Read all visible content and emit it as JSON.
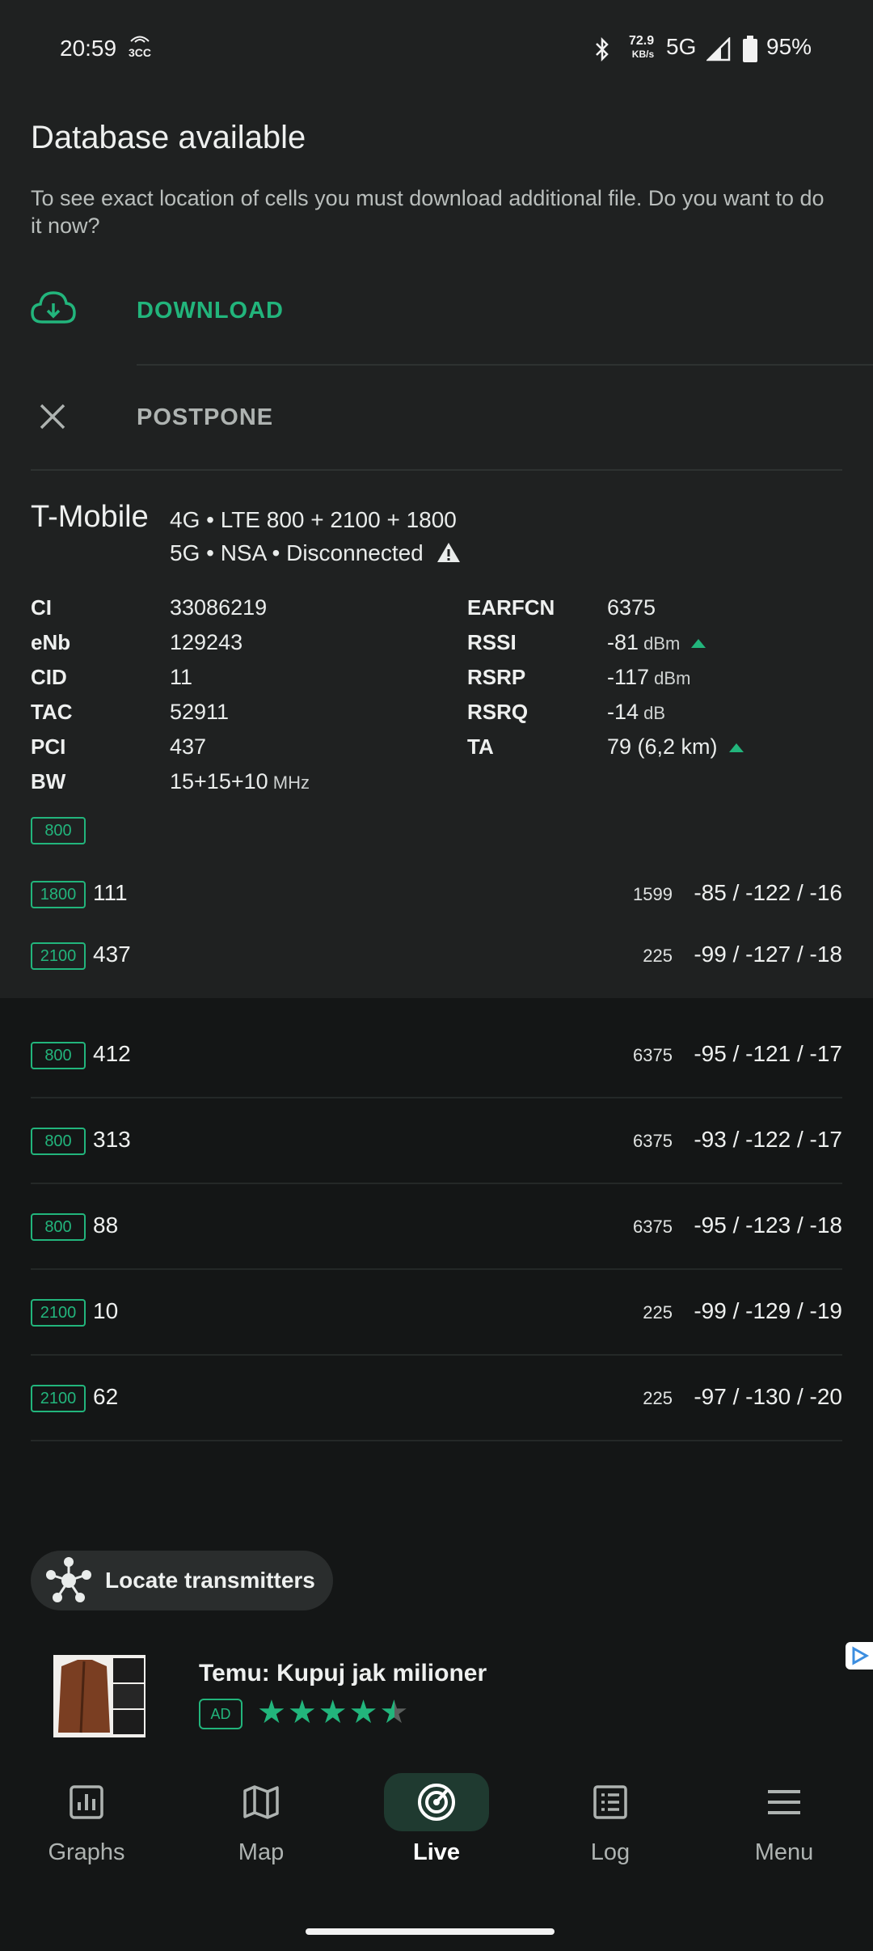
{
  "status_bar": {
    "time": "20:59",
    "carrier_icon_text": "3CC",
    "speed_value": "72.9",
    "speed_unit": "KB/s",
    "network": "5G",
    "battery": "95%"
  },
  "dialog": {
    "title": "Database available",
    "text": "To see exact location of cells you must download additional file. Do you want to do it now?",
    "download_label": "DOWNLOAD",
    "postpone_label": "POSTPONE"
  },
  "serving": {
    "carrier": "T-Mobile",
    "tech_line1": "4G • LTE 800 + 2100 + 1800",
    "tech_line2": "5G • NSA • Disconnected",
    "left_params": [
      {
        "key": "CI",
        "value": "33086219",
        "unit": ""
      },
      {
        "key": "eNb",
        "value": "129243",
        "unit": ""
      },
      {
        "key": "CID",
        "value": "11",
        "unit": ""
      },
      {
        "key": "TAC",
        "value": "52911",
        "unit": ""
      },
      {
        "key": "PCI",
        "value": "437",
        "unit": ""
      },
      {
        "key": "BW",
        "value": "15+15+10",
        "unit": "MHz"
      }
    ],
    "right_params": [
      {
        "key": "EARFCN",
        "value": "6375",
        "unit": ""
      },
      {
        "key": "RSSI",
        "value": "-81",
        "unit": "dBm"
      },
      {
        "key": "RSRP",
        "value": "-117",
        "unit": "dBm"
      },
      {
        "key": "RSRQ",
        "value": "-14",
        "unit": "dB"
      },
      {
        "key": "TA",
        "value": "79 (6,2 km)",
        "unit": ""
      }
    ],
    "primary_band": "800",
    "aggregated": [
      {
        "band": "1800",
        "pci": "111",
        "freq": "1599",
        "signal": "-85 / -122 / -16"
      },
      {
        "band": "2100",
        "pci": "437",
        "freq": "225",
        "signal": "-99 / -127 / -18"
      }
    ]
  },
  "neighbors": [
    {
      "band": "800",
      "pci": "412",
      "freq": "6375",
      "signal": "-95 / -121 / -17"
    },
    {
      "band": "800",
      "pci": "313",
      "freq": "6375",
      "signal": "-93 / -122 / -17"
    },
    {
      "band": "800",
      "pci": "88",
      "freq": "6375",
      "signal": "-95 / -123 / -18"
    },
    {
      "band": "2100",
      "pci": "10",
      "freq": "225",
      "signal": "-99 / -129 / -19"
    },
    {
      "band": "2100",
      "pci": "62",
      "freq": "225",
      "signal": "-97 / -130 / -20"
    }
  ],
  "locate_button": "Locate transmitters",
  "ad": {
    "title": "Temu: Kupuj jak milioner",
    "badge": "AD",
    "rating": 4.5
  },
  "nav": [
    {
      "label": "Graphs",
      "icon": "graphs-icon"
    },
    {
      "label": "Map",
      "icon": "map-icon"
    },
    {
      "label": "Live",
      "icon": "live-icon",
      "active": true
    },
    {
      "label": "Log",
      "icon": "log-icon"
    },
    {
      "label": "Menu",
      "icon": "menu-icon"
    }
  ],
  "colors": {
    "accent": "#22b57c",
    "panel": "#1f2121",
    "background": "#141616"
  }
}
